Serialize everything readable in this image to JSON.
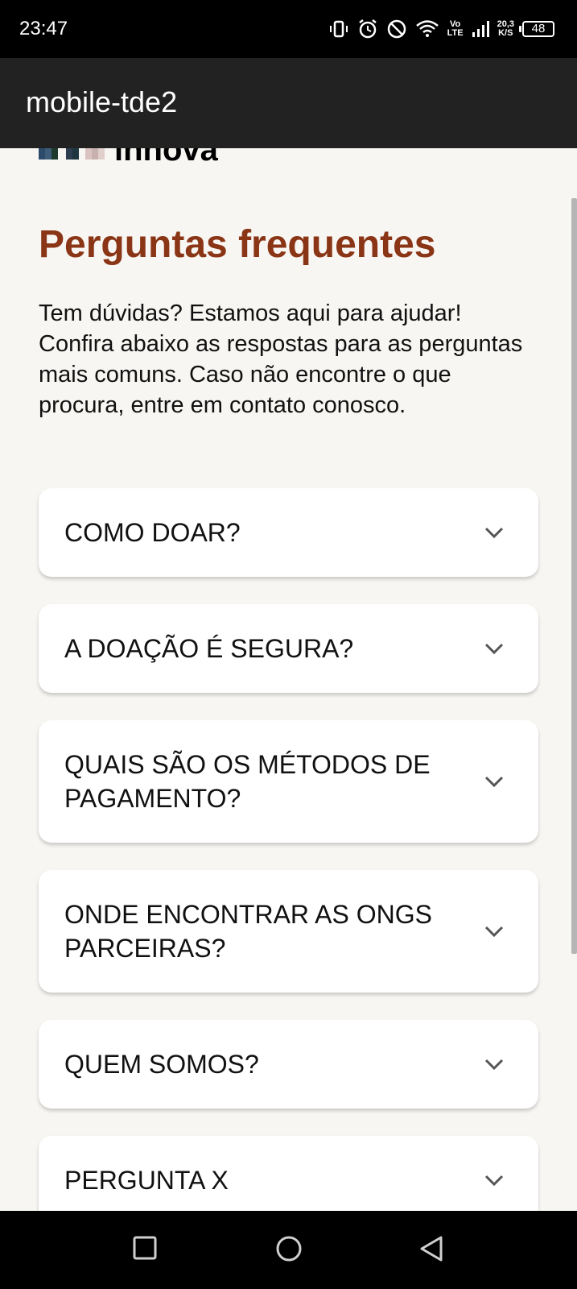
{
  "status_bar": {
    "time": "23:47",
    "volte_top": "Vo",
    "volte_bottom": "LTE",
    "speed_value": "20,3",
    "speed_unit": "K/S",
    "battery": "48"
  },
  "app_bar": {
    "title": "mobile-tde2"
  },
  "header": {
    "logo_text": "innova"
  },
  "faq": {
    "title": "Perguntas frequentes",
    "intro": "Tem dúvidas? Estamos aqui para ajudar! Confira abaixo as respostas para as perguntas mais comuns. Caso não encontre o que procura, entre em contato conosco.",
    "items": [
      {
        "question": "COMO DOAR?"
      },
      {
        "question": "A DOAÇÃO É SEGURA?"
      },
      {
        "question": "QUAIS SÃO OS MÉTODOS DE PAGAMENTO?"
      },
      {
        "question": "ONDE ENCONTRAR AS ONGS PARCEIRAS?"
      },
      {
        "question": "QUEM SOMOS?"
      },
      {
        "question": "PERGUNTA X"
      }
    ]
  },
  "colors": {
    "title": "#8a3515",
    "background": "#f8f6f3",
    "app_bar": "#222222"
  },
  "icons": {
    "expand": "chevron-down-icon",
    "nav_recent": "square-icon",
    "nav_home": "circle-icon",
    "nav_back": "triangle-back-icon"
  }
}
